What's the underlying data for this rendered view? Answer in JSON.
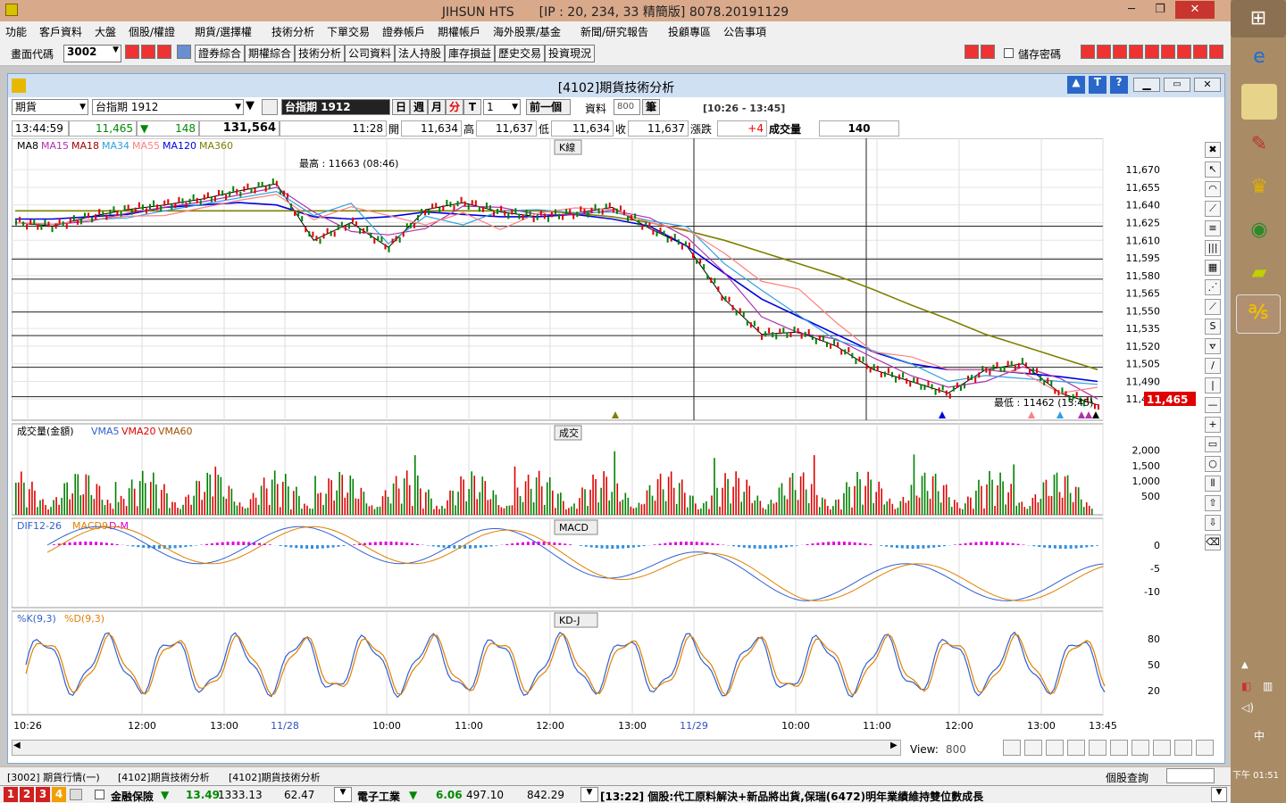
{
  "window": {
    "title": "JIHSUN HTS　　[IP : 20, 234, 33 精簡版] 8078.20191129"
  },
  "menu": [
    "功能",
    "客戶資料",
    "大盤",
    "個股/權證",
    "期貨/選擇權",
    "技術分析",
    "下單交易",
    "證券帳戶",
    "期權帳戶",
    "海外股票/基金",
    "新聞/研究報告",
    "投顧專區",
    "公告事項"
  ],
  "toolbar": {
    "code_label": "畫面代碼",
    "code_value": "3002",
    "buttons": [
      "證券綜合",
      "期權綜合",
      "技術分析",
      "公司資料",
      "法人持股",
      "庫存損益",
      "歷史交易",
      "投資現況"
    ],
    "save_password": "儲存密碼"
  },
  "inner": {
    "title": "[4102]期貨技術分析",
    "product_type": "期貨",
    "product": "台指期 1912",
    "product_badge": "台指期 1912",
    "periods": [
      "日",
      "週",
      "月",
      "分",
      "T"
    ],
    "period_value": "1",
    "prev": "前一個",
    "data_label": "資料",
    "data_count": "800",
    "data_unit": "筆",
    "range": "[10:26 - 13:45]"
  },
  "quote": {
    "time": "13:44:59",
    "last": "11,465",
    "change": "148",
    "volume_total": "131,564",
    "cursor_time": "11:28",
    "open_label": "開",
    "open": "11,634",
    "high_label": "高",
    "high": "11,637",
    "low_label": "低",
    "low": "11,634",
    "close_label": "收",
    "close": "11,637",
    "chg_label": "漲跌",
    "chg": "+4",
    "vol_label": "成交量",
    "vol": "140"
  },
  "panels": {
    "kline": {
      "legend": [
        "MA8",
        "MA15",
        "MA18",
        "MA34",
        "MA55",
        "MA120",
        "MA360"
      ],
      "badge": "K線",
      "high_note": "最高 : 11663 (08:46)",
      "low_note": "最低 : 11462 (13:45)",
      "last_tag": "11,465"
    },
    "volume": {
      "legend": [
        "成交量(金額)",
        "VMA5",
        "VMA20",
        "VMA60"
      ],
      "badge": "成交"
    },
    "macd": {
      "legend": [
        "DIF12-26",
        "MACD9",
        "D-M"
      ],
      "badge": "MACD"
    },
    "kd": {
      "legend": [
        "%K(9,3)",
        "%D(9,3)"
      ],
      "badge": "KD-J"
    }
  },
  "colors": {
    "MA8": "#000000",
    "MA15": "#b030b0",
    "MA18": "#a00000",
    "MA34": "#30a0e0",
    "MA55": "#ff8080",
    "MA120": "#0000e0",
    "MA360": "#808000"
  },
  "scroll": {
    "view_label": "View:",
    "view_value": "800"
  },
  "status": {
    "tabs": [
      "[3002] 期貨行情(一)",
      "[4102]期貨技術分析",
      "[4102]期貨技術分析"
    ],
    "stock_query": "個股查詢"
  },
  "ticker": {
    "nums": [
      "1",
      "2",
      "3",
      "4"
    ],
    "item1": "金融保險",
    "item1_chg": "13.49",
    "item1_val": "1333.13",
    "item1_vol": "62.47",
    "item2": "電子工業",
    "item2_chg": "6.06",
    "item2_val": "497.10",
    "item2_vol": "842.29",
    "news": "[13:22] 個股:代工原料解決+新品將出貨,保瑞(6472)明年業績維持雙位數成長"
  },
  "clock": {
    "time": "下午 01:51"
  },
  "chart_data": [
    {
      "type": "line",
      "title": "K線",
      "ylim": [
        11460,
        11680
      ],
      "yticks": [
        11670,
        11655,
        11640,
        11625,
        11610,
        11595,
        11580,
        11565,
        11550,
        11535,
        11520,
        11505,
        11490,
        11475
      ],
      "xticks": [
        "10:26",
        "12:00",
        "13:00",
        "11/28",
        "10:00",
        "11:00",
        "12:00",
        "13:00",
        "11/29",
        "10:00",
        "11:00",
        "12:00",
        "13:00",
        "13:45"
      ],
      "series": [
        {
          "name": "MA8",
          "values": [
            11625,
            11622,
            11630,
            11636,
            11640,
            11645,
            11652,
            11658,
            11610,
            11625,
            11604,
            11636,
            11642,
            11634,
            11630,
            11633,
            11638,
            11620,
            11605,
            11560,
            11530,
            11532,
            11520,
            11500,
            11490,
            11480,
            11500,
            11505,
            11480,
            11470
          ]
        },
        {
          "name": "MA120",
          "values": [
            11628,
            11628,
            11630,
            11632,
            11638,
            11640,
            11642,
            11640,
            11630,
            11628,
            11630,
            11634,
            11632,
            11630,
            11630,
            11632,
            11628,
            11622,
            11605,
            11582,
            11560,
            11545,
            11530,
            11515,
            11505,
            11500,
            11500,
            11497,
            11494,
            11490
          ]
        },
        {
          "name": "MA360",
          "values": [
            11635,
            11635,
            11635,
            11635,
            11635,
            11635,
            11635,
            11635,
            11635,
            11635,
            11635,
            11635,
            11635,
            11635,
            11635,
            11633,
            11630,
            11625,
            11618,
            11610,
            11600,
            11590,
            11580,
            11568,
            11555,
            11543,
            11530,
            11520,
            11510,
            11500
          ]
        }
      ]
    },
    {
      "type": "bar",
      "title": "成交",
      "yticks": [
        2000,
        1500,
        1000,
        500
      ]
    },
    {
      "type": "line",
      "title": "MACD",
      "yticks": [
        0,
        -5,
        -10
      ]
    },
    {
      "type": "line",
      "title": "KD-J",
      "yticks": [
        80,
        50,
        20
      ]
    }
  ]
}
